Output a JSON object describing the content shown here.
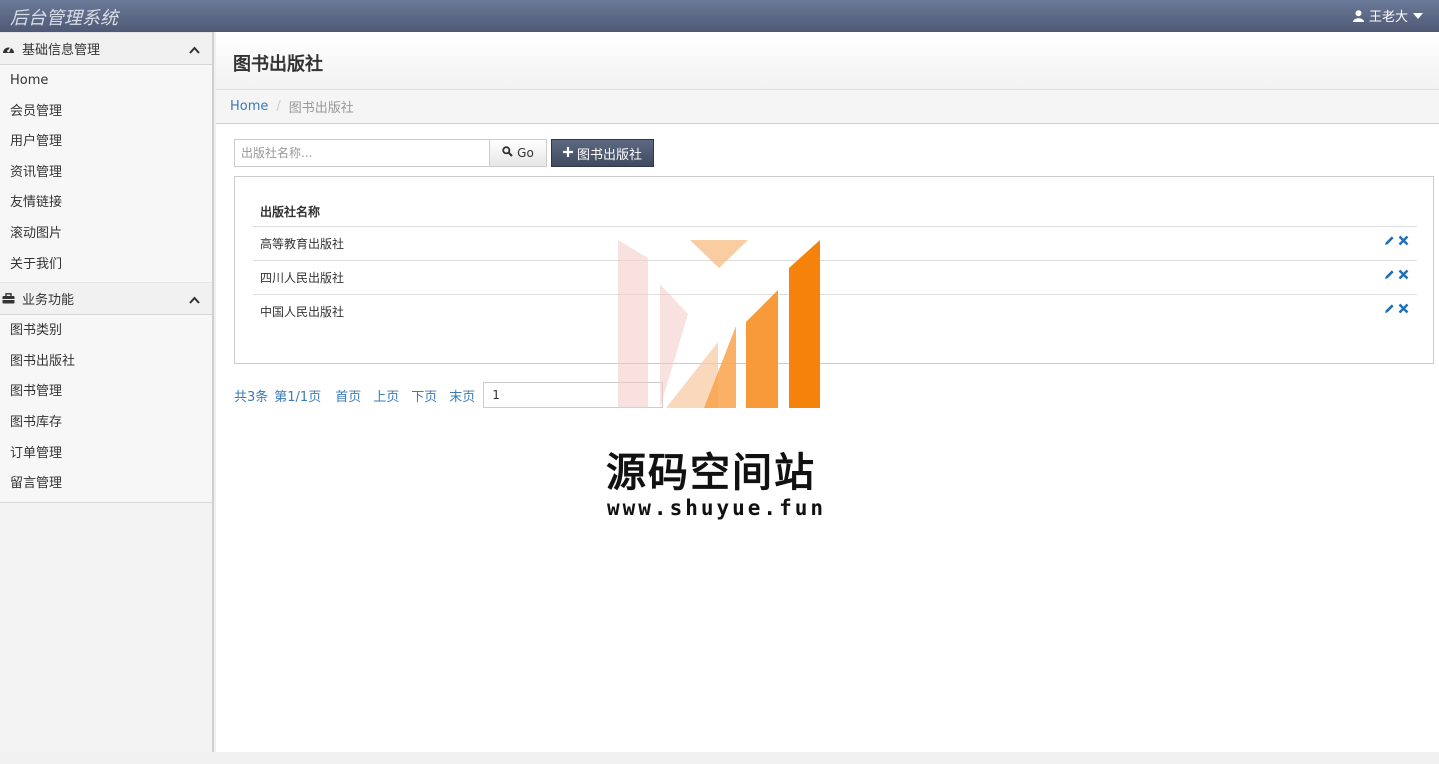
{
  "app": {
    "title": "后台管理系统",
    "user": "王老大"
  },
  "sidebar": {
    "groups": [
      {
        "label": "基础信息管理",
        "icon": "dashboard-icon",
        "items": [
          "Home",
          "会员管理",
          "用户管理",
          "资讯管理",
          "友情链接",
          "滚动图片",
          "关于我们"
        ]
      },
      {
        "label": "业务功能",
        "icon": "briefcase-icon",
        "items": [
          "图书类别",
          "图书出版社",
          "图书管理",
          "图书库存",
          "订单管理",
          "留言管理"
        ]
      }
    ]
  },
  "page": {
    "title": "图书出版社",
    "breadcrumb": {
      "home": "Home",
      "current": "图书出版社"
    },
    "search_placeholder": "出版社名称...",
    "go_label": "Go",
    "add_label": "图书出版社",
    "table": {
      "header": "出版社名称",
      "rows": [
        "高等教育出版社",
        "四川人民出版社",
        "中国人民出版社"
      ]
    },
    "pager": {
      "total": "共3条",
      "page_info": "第1/1页",
      "first": "首页",
      "prev": "上页",
      "next": "下页",
      "last": "末页",
      "page_input": "1"
    }
  },
  "watermark": {
    "title": "源码空间站",
    "url": "www.shuyue.fun"
  },
  "colors": {
    "topbar": "#5a6680",
    "link": "#3a7ab8",
    "add_button": "#4a556c",
    "icon_blue": "#1f6fb5",
    "accent_orange": "#f7931e"
  }
}
